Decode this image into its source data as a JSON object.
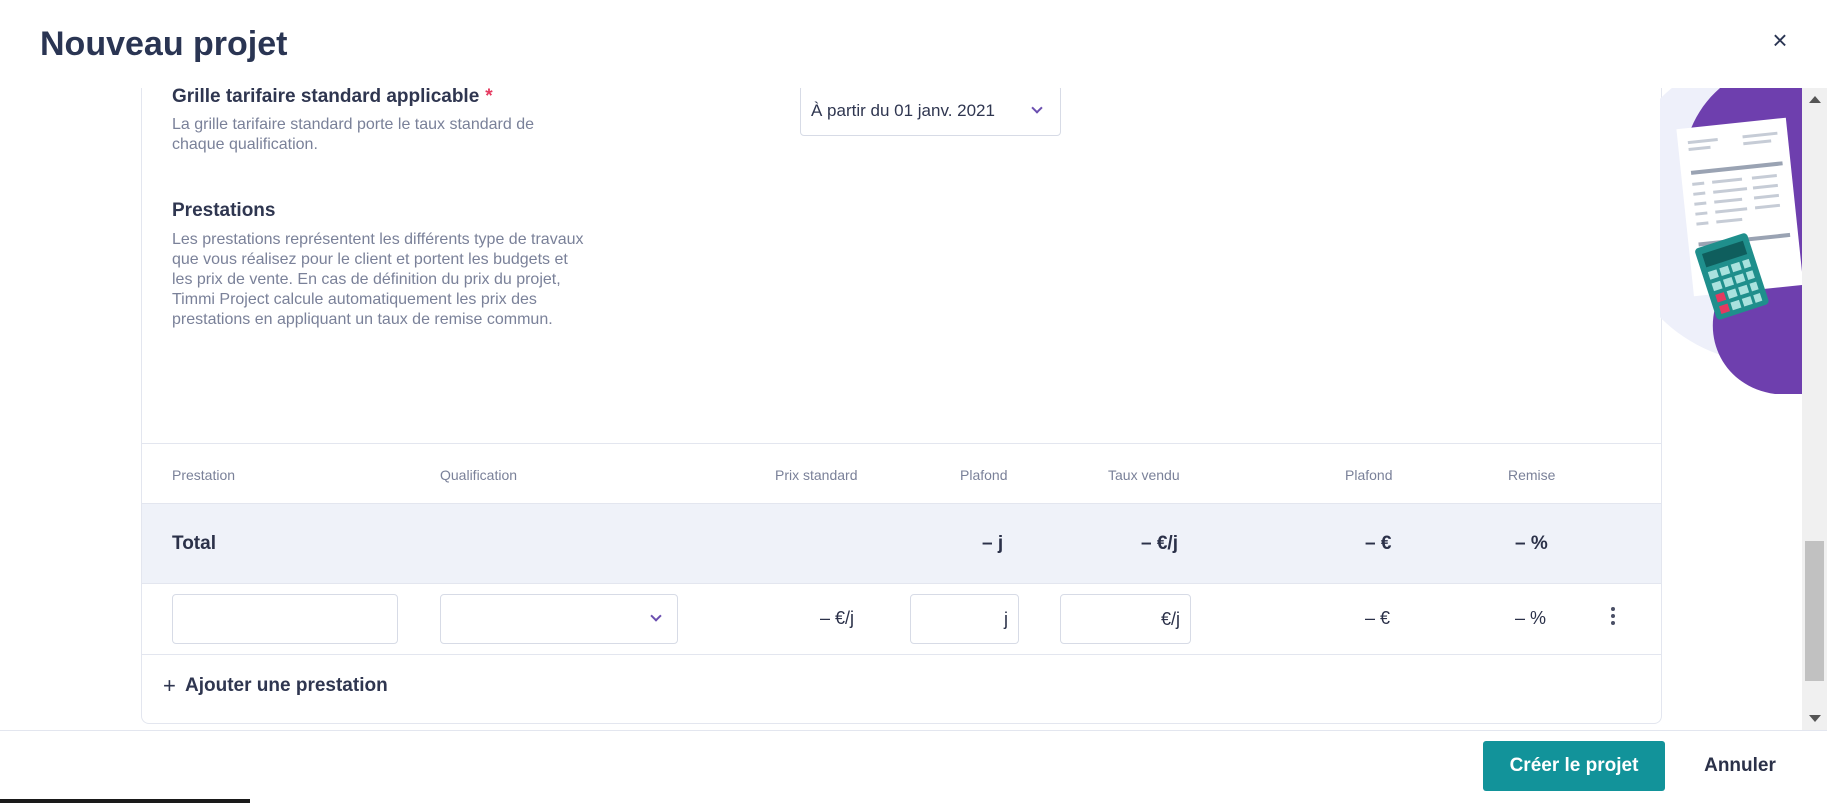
{
  "dialog": {
    "title": "Nouveau projet"
  },
  "grid": {
    "label": "Grille tarifaire standard applicable",
    "required_mark": "*",
    "description": "La grille tarifaire standard porte le taux standard de chaque qualification.",
    "selected": "À partir du 01 janv. 2021"
  },
  "prestations": {
    "label": "Prestations",
    "description": "Les prestations représentent les différents type de travaux que vous réalisez pour le client et portent les budgets et les prix de vente. En cas de définition du prix du projet, Timmi Project calcule automatiquement les prix des prestations en appliquant un taux de remise commun."
  },
  "table": {
    "headers": {
      "prestation": "Prestation",
      "qualification": "Qualification",
      "prix_standard": "Prix standard",
      "plafond_days": "Plafond",
      "taux_vendu": "Taux vendu",
      "plafond_amount": "Plafond",
      "remise": "Remise"
    },
    "total": {
      "label": "Total",
      "plafond_days": "–  j",
      "taux_vendu": "– €/j",
      "plafond_amount": "–  €",
      "remise": "– %"
    },
    "row": {
      "prestation_value": "",
      "qualification_value": "",
      "prix_standard": "–  €/j",
      "plafond_suffix": "j",
      "taux_suffix": "€/j",
      "plafond_amount": "–  €",
      "remise": "– %"
    },
    "add_label": "Ajouter une prestation",
    "add_icon": "+"
  },
  "footer": {
    "create_label": "Créer le projet",
    "cancel_label": "Annuler"
  },
  "icons": {
    "close": "×"
  },
  "colors": {
    "primary": "#12939a",
    "accent_purple": "#6b3fa8",
    "required": "#e5395f"
  }
}
